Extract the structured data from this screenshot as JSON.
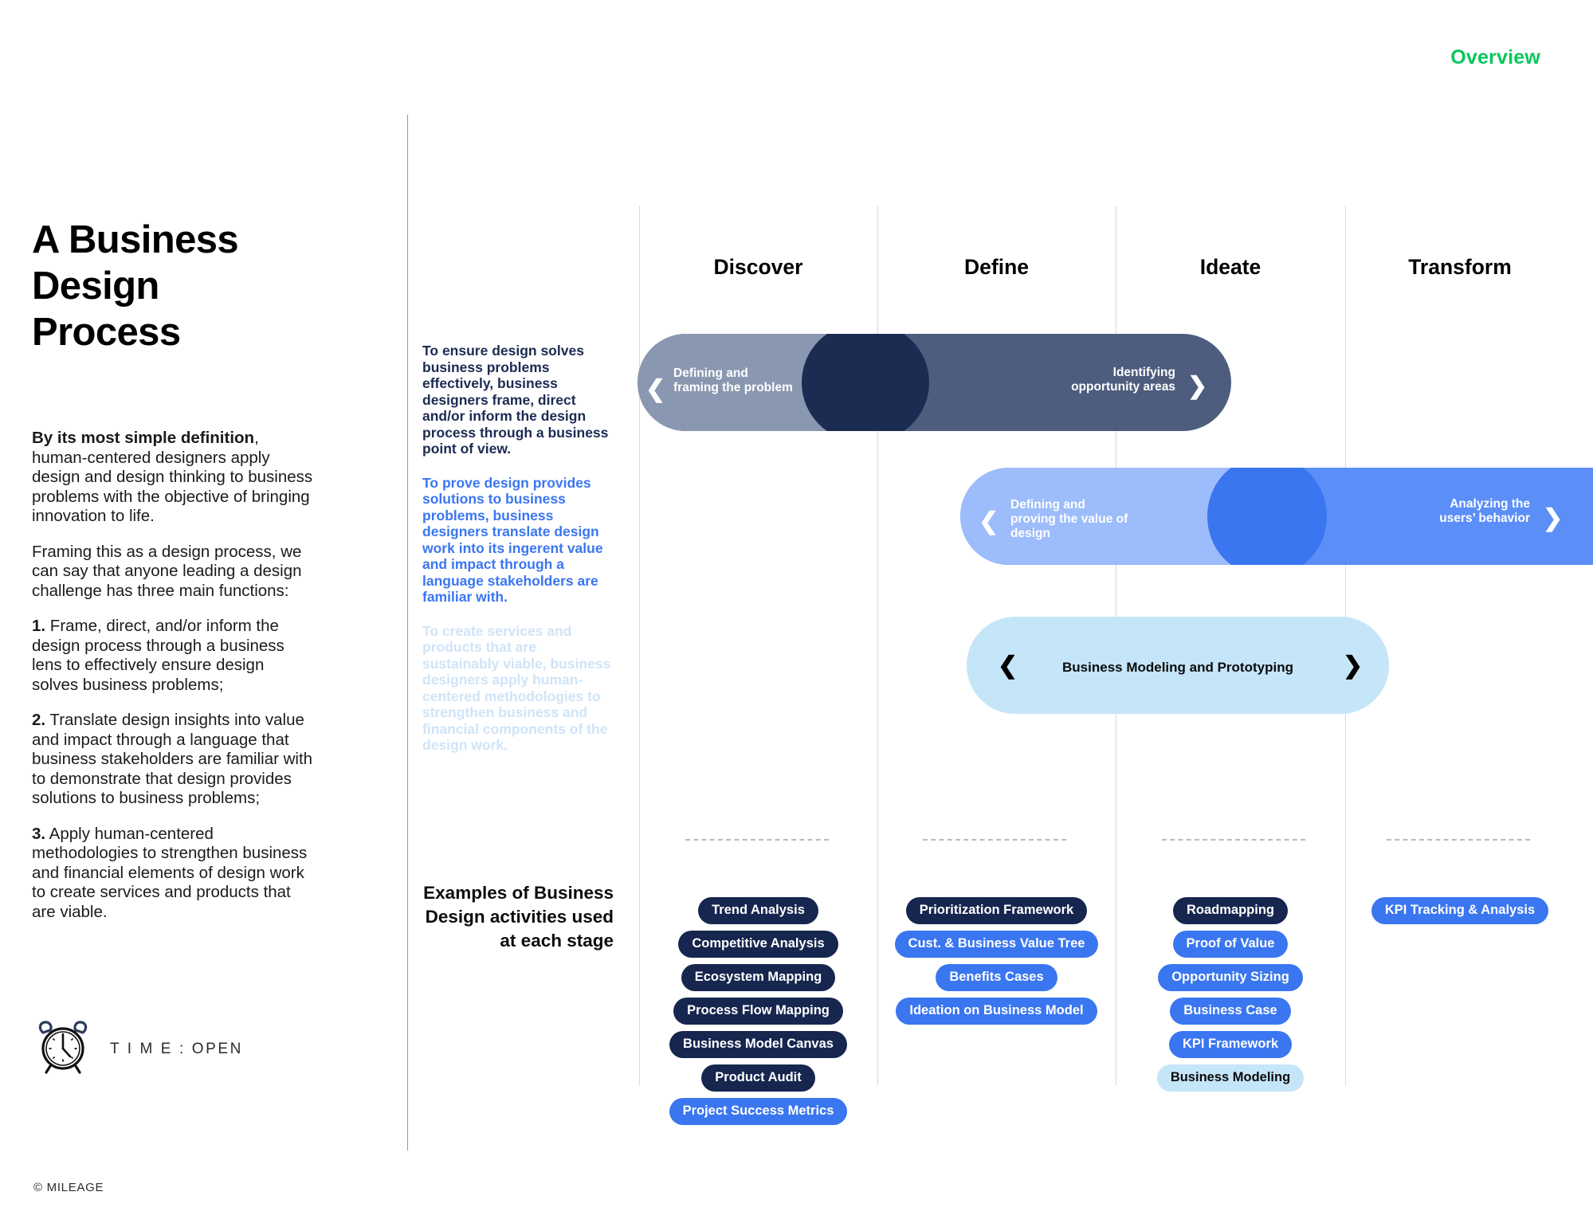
{
  "header": {
    "overview_label": "Overview"
  },
  "left": {
    "title": "A Business Design Process",
    "paragraphs": [
      {
        "lead": "By its most simple definition",
        "rest": ", human-centered designers apply design and design thinking to business problems with the objective of bringing innovation to life."
      },
      {
        "lead": "",
        "rest": "Framing this as a design process, we can say that anyone leading a design challenge has three main functions:"
      },
      {
        "lead": "1.",
        "rest": " Frame, direct, and/or inform the design process through a business lens to effectively ensure design solves business problems;"
      },
      {
        "lead": "2.",
        "rest": " Translate design insights into value and impact through a language that business stakeholders are familiar with to demonstrate that design provides solutions to business problems;"
      },
      {
        "lead": "3.",
        "rest": " Apply human-centered methodologies to strengthen business and financial elements of design work to create services and products that are viable."
      }
    ],
    "time_label": "T I M E : OPEN",
    "clock_icon": "alarm-clock-icon",
    "footer": "© MILEAGE"
  },
  "intents": [
    {
      "text": "To ensure design solves business problems effectively, business designers frame, direct and/or inform the design process through a business point of view.",
      "color": "#1b2b52"
    },
    {
      "text": "To prove design provides solutions to business problems, business designers translate design work into its ingerent value and impact through a language stakeholders are familiar with.",
      "color": "#3a76f0"
    },
    {
      "text": "To create services and products that are sustainably viable, business designers apply human-centered methodologies to strengthen business and financial components of the design work.",
      "color": "#cfe4f8"
    }
  ],
  "examples_label": "Examples of Business Design activities used at each stage",
  "stages": [
    {
      "label": "Discover"
    },
    {
      "label": "Define"
    },
    {
      "label": "Ideate"
    },
    {
      "label": "Transform"
    }
  ],
  "phases": [
    {
      "name": "frame-phase",
      "left_label": "Defining and framing the problem",
      "right_label": "Identifying opportunity areas",
      "center_label": "",
      "left_chevron": "chevron-left-icon",
      "right_chevron": "chevron-right-icon",
      "colors": {
        "left": "#8a97b0",
        "right": "#4e5d7e",
        "blob": "#1b2b52"
      }
    },
    {
      "name": "value-phase",
      "left_label": "Defining and proving the value of design",
      "right_label": "Analyzing the users’ behavior",
      "center_label": "",
      "left_chevron": "chevron-left-icon",
      "right_chevron": "chevron-right-icon",
      "colors": {
        "left": "#9cbcfb",
        "right": "#5b8ff7",
        "blob": "#3a76f0"
      }
    },
    {
      "name": "modeling-phase",
      "left_label": "",
      "right_label": "",
      "center_label": "Business Modeling and Prototyping",
      "left_chevron": "chevron-left-icon",
      "right_chevron": "chevron-right-icon",
      "colors": {
        "left": "#c5e5f8",
        "right": "#c5e5f8",
        "blob": "#c5e5f8"
      }
    }
  ],
  "activities": {
    "discover": [
      {
        "label": "Trend Analysis",
        "style": "navy"
      },
      {
        "label": "Competitive Analysis",
        "style": "navy"
      },
      {
        "label": "Ecosystem Mapping",
        "style": "navy"
      },
      {
        "label": "Process Flow Mapping",
        "style": "navy"
      },
      {
        "label": "Business Model Canvas",
        "style": "navy"
      },
      {
        "label": "Product Audit",
        "style": "navy"
      },
      {
        "label": "Project Success Metrics",
        "style": "blue"
      }
    ],
    "define": [
      {
        "label": "Prioritization Framework",
        "style": "navy"
      },
      {
        "label": "Cust. & Business Value Tree",
        "style": "blue"
      },
      {
        "label": "Benefits Cases",
        "style": "blue"
      },
      {
        "label": "Ideation on Business Model",
        "style": "blue"
      }
    ],
    "ideate": [
      {
        "label": "Roadmapping",
        "style": "navy"
      },
      {
        "label": "Proof of Value",
        "style": "blue"
      },
      {
        "label": "Opportunity Sizing",
        "style": "blue"
      },
      {
        "label": "Business Case",
        "style": "blue"
      },
      {
        "label": "KPI Framework",
        "style": "blue"
      },
      {
        "label": "Business Modeling",
        "style": "sky"
      }
    ],
    "transform": [
      {
        "label": "KPI Tracking & Analysis",
        "style": "blue"
      }
    ]
  },
  "colors": {
    "accent_green": "#06c75a",
    "navy": "#16264f",
    "blue": "#3a76f0",
    "sky": "#c5e5f8",
    "slate_light": "#8a97b0",
    "slate_dark": "#4e5d7e"
  }
}
